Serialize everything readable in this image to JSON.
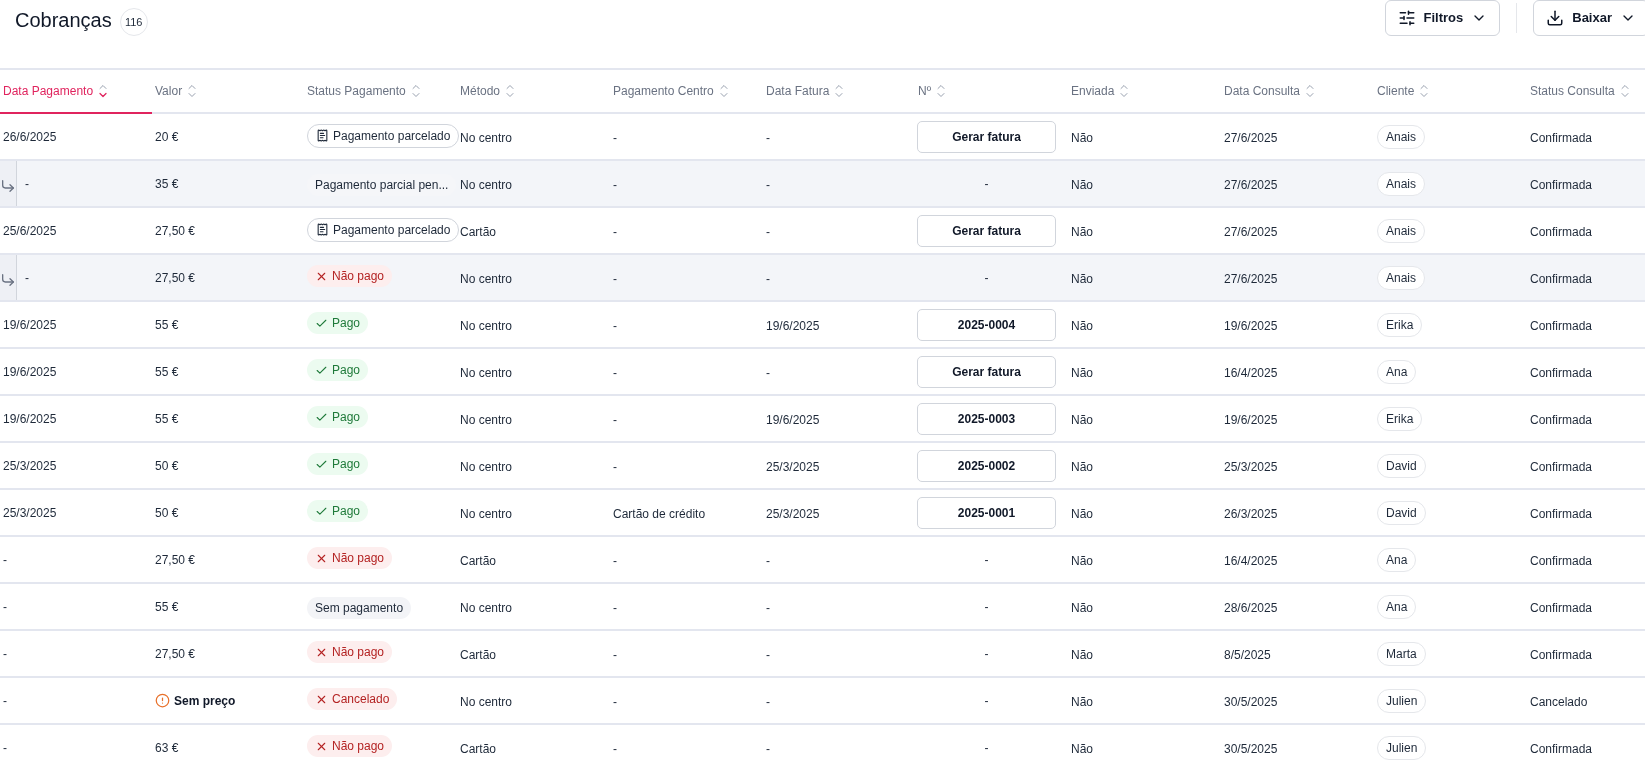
{
  "header": {
    "title": "Cobranças",
    "count": "116",
    "buttons": [
      {
        "kind": "filter",
        "label": "Filtros"
      },
      {
        "kind": "download",
        "label": "Baixar"
      }
    ]
  },
  "table": {
    "columns": [
      {
        "label": "Data Pagamento",
        "sorted": true
      },
      {
        "label": "Valor",
        "sorted": false
      },
      {
        "label": "Status Pagamento",
        "sorted": false
      },
      {
        "label": "Método",
        "sorted": false
      },
      {
        "label": "Pagamento Centro",
        "sorted": false
      },
      {
        "label": "Data Fatura",
        "sorted": false
      },
      {
        "label": "Nº",
        "sorted": false
      },
      {
        "label": "Enviada",
        "sorted": false
      },
      {
        "label": "Data Consulta",
        "sorted": false
      },
      {
        "label": "Cliente",
        "sorted": false
      },
      {
        "label": "Status Consulta",
        "sorted": false
      }
    ],
    "rows": [
      {
        "child": false,
        "data_pagamento": "26/6/2025",
        "valor": {
          "kind": "price",
          "text": "20 €"
        },
        "status": {
          "kind": "installment",
          "text": "Pagamento parcelado"
        },
        "metodo": "No centro",
        "pagamento_centro": "-",
        "data_fatura": "-",
        "numero": {
          "kind": "button",
          "text": "Gerar fatura"
        },
        "enviada": "Não",
        "data_consulta": "27/6/2025",
        "cliente": "Anais",
        "status_consulta": "Confirmada"
      },
      {
        "child": true,
        "data_pagamento": "-",
        "valor": {
          "kind": "price",
          "text": "35 €"
        },
        "status": {
          "kind": "partial",
          "text": "Pagamento parcial pen..."
        },
        "metodo": "No centro",
        "pagamento_centro": "-",
        "data_fatura": "-",
        "numero": {
          "kind": "text",
          "text": "-"
        },
        "enviada": "Não",
        "data_consulta": "27/6/2025",
        "cliente": "Anais",
        "status_consulta": "Confirmada"
      },
      {
        "child": false,
        "data_pagamento": "25/6/2025",
        "valor": {
          "kind": "price",
          "text": "27,50 €"
        },
        "status": {
          "kind": "installment",
          "text": "Pagamento parcelado"
        },
        "metodo": "Cartão",
        "pagamento_centro": "-",
        "data_fatura": "-",
        "numero": {
          "kind": "button",
          "text": "Gerar fatura"
        },
        "enviada": "Não",
        "data_consulta": "27/6/2025",
        "cliente": "Anais",
        "status_consulta": "Confirmada"
      },
      {
        "child": true,
        "data_pagamento": "-",
        "valor": {
          "kind": "price",
          "text": "27,50 €"
        },
        "status": {
          "kind": "unpaid",
          "text": "Não pago"
        },
        "metodo": "No centro",
        "pagamento_centro": "-",
        "data_fatura": "-",
        "numero": {
          "kind": "text",
          "text": "-"
        },
        "enviada": "Não",
        "data_consulta": "27/6/2025",
        "cliente": "Anais",
        "status_consulta": "Confirmada"
      },
      {
        "child": false,
        "data_pagamento": "19/6/2025",
        "valor": {
          "kind": "price",
          "text": "55 €"
        },
        "status": {
          "kind": "paid",
          "text": "Pago"
        },
        "metodo": "No centro",
        "pagamento_centro": "-",
        "data_fatura": "19/6/2025",
        "numero": {
          "kind": "button",
          "text": "2025-0004"
        },
        "enviada": "Não",
        "data_consulta": "19/6/2025",
        "cliente": "Erika",
        "status_consulta": "Confirmada"
      },
      {
        "child": false,
        "data_pagamento": "19/6/2025",
        "valor": {
          "kind": "price",
          "text": "55 €"
        },
        "status": {
          "kind": "paid",
          "text": "Pago"
        },
        "metodo": "No centro",
        "pagamento_centro": "-",
        "data_fatura": "-",
        "numero": {
          "kind": "button",
          "text": "Gerar fatura"
        },
        "enviada": "Não",
        "data_consulta": "16/4/2025",
        "cliente": "Ana",
        "status_consulta": "Confirmada"
      },
      {
        "child": false,
        "data_pagamento": "19/6/2025",
        "valor": {
          "kind": "price",
          "text": "55 €"
        },
        "status": {
          "kind": "paid",
          "text": "Pago"
        },
        "metodo": "No centro",
        "pagamento_centro": "-",
        "data_fatura": "19/6/2025",
        "numero": {
          "kind": "button",
          "text": "2025-0003"
        },
        "enviada": "Não",
        "data_consulta": "19/6/2025",
        "cliente": "Erika",
        "status_consulta": "Confirmada"
      },
      {
        "child": false,
        "data_pagamento": "25/3/2025",
        "valor": {
          "kind": "price",
          "text": "50 €"
        },
        "status": {
          "kind": "paid",
          "text": "Pago"
        },
        "metodo": "No centro",
        "pagamento_centro": "-",
        "data_fatura": "25/3/2025",
        "numero": {
          "kind": "button",
          "text": "2025-0002"
        },
        "enviada": "Não",
        "data_consulta": "25/3/2025",
        "cliente": "David",
        "status_consulta": "Confirmada"
      },
      {
        "child": false,
        "data_pagamento": "25/3/2025",
        "valor": {
          "kind": "price",
          "text": "50 €"
        },
        "status": {
          "kind": "paid",
          "text": "Pago"
        },
        "metodo": "No centro",
        "pagamento_centro": "Cartão de crédito",
        "data_fatura": "25/3/2025",
        "numero": {
          "kind": "button",
          "text": "2025-0001"
        },
        "enviada": "Não",
        "data_consulta": "26/3/2025",
        "cliente": "David",
        "status_consulta": "Confirmada"
      },
      {
        "child": false,
        "data_pagamento": "-",
        "valor": {
          "kind": "price",
          "text": "27,50 €"
        },
        "status": {
          "kind": "unpaid",
          "text": "Não pago"
        },
        "metodo": "Cartão",
        "pagamento_centro": "-",
        "data_fatura": "-",
        "numero": {
          "kind": "text",
          "text": "-"
        },
        "enviada": "Não",
        "data_consulta": "16/4/2025",
        "cliente": "Ana",
        "status_consulta": "Confirmada"
      },
      {
        "child": false,
        "data_pagamento": "-",
        "valor": {
          "kind": "price",
          "text": "55 €"
        },
        "status": {
          "kind": "none",
          "text": "Sem pagamento"
        },
        "metodo": "No centro",
        "pagamento_centro": "-",
        "data_fatura": "-",
        "numero": {
          "kind": "text",
          "text": "-"
        },
        "enviada": "Não",
        "data_consulta": "28/6/2025",
        "cliente": "Ana",
        "status_consulta": "Confirmada"
      },
      {
        "child": false,
        "data_pagamento": "-",
        "valor": {
          "kind": "price",
          "text": "27,50 €"
        },
        "status": {
          "kind": "unpaid",
          "text": "Não pago"
        },
        "metodo": "Cartão",
        "pagamento_centro": "-",
        "data_fatura": "-",
        "numero": {
          "kind": "text",
          "text": "-"
        },
        "enviada": "Não",
        "data_consulta": "8/5/2025",
        "cliente": "Marta",
        "status_consulta": "Confirmada"
      },
      {
        "child": false,
        "data_pagamento": "-",
        "valor": {
          "kind": "no_price",
          "text": "Sem preço"
        },
        "status": {
          "kind": "cancelled",
          "text": "Cancelado"
        },
        "metodo": "No centro",
        "pagamento_centro": "-",
        "data_fatura": "-",
        "numero": {
          "kind": "text",
          "text": "-"
        },
        "enviada": "Não",
        "data_consulta": "30/5/2025",
        "cliente": "Julien",
        "status_consulta": "Cancelado"
      },
      {
        "child": false,
        "data_pagamento": "-",
        "valor": {
          "kind": "price",
          "text": "63 €"
        },
        "status": {
          "kind": "unpaid",
          "text": "Não pago"
        },
        "metodo": "Cartão",
        "pagamento_centro": "-",
        "data_fatura": "-",
        "numero": {
          "kind": "text",
          "text": "-"
        },
        "enviada": "Não",
        "data_consulta": "30/5/2025",
        "cliente": "Julien",
        "status_consulta": "Confirmada"
      }
    ]
  }
}
